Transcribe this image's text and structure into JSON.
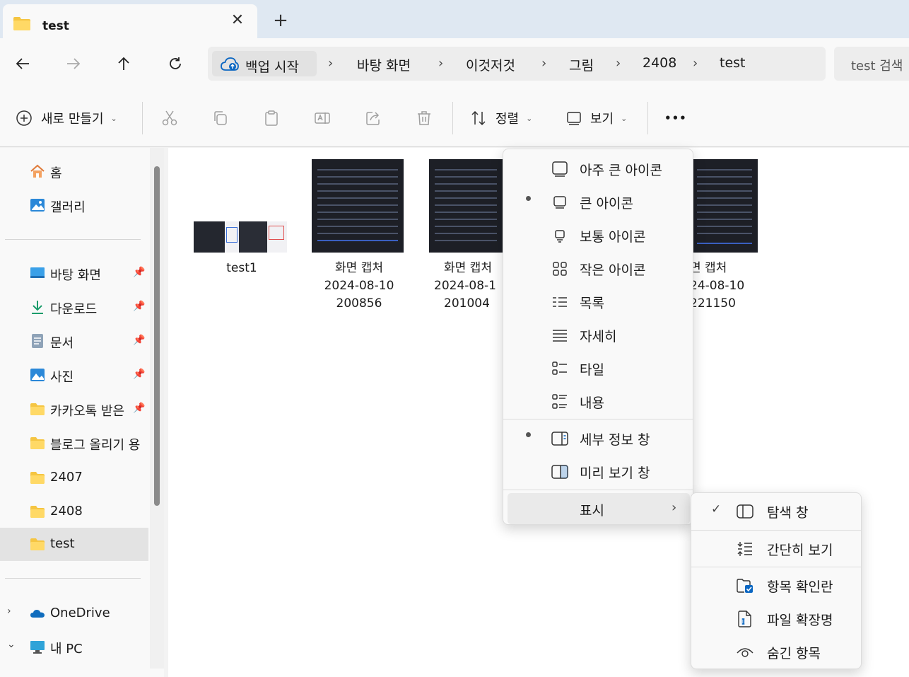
{
  "tab": {
    "title": "test",
    "close": "✕",
    "new": "+"
  },
  "address": {
    "backup": "백업 시작",
    "crumbs": [
      "바탕 화면",
      "이것저것",
      "그림",
      "2408",
      "test"
    ],
    "separator": "›"
  },
  "search": {
    "placeholder": "test 검색"
  },
  "toolbar": {
    "new_label": "새로 만들기",
    "sort_label": "정렬",
    "view_label": "보기",
    "more_label": "•••",
    "chevron": "⌄"
  },
  "sidebar": {
    "pin": "📌",
    "items": [
      {
        "label": "홈"
      },
      {
        "label": "갤러리"
      },
      {
        "label": "바탕 화면"
      },
      {
        "label": "다운로드"
      },
      {
        "label": "문서"
      },
      {
        "label": "사진"
      },
      {
        "label": "카카오톡 받은"
      },
      {
        "label": "블로그 올리기 용"
      },
      {
        "label": "2407"
      },
      {
        "label": "2408"
      },
      {
        "label": "test"
      },
      {
        "label": "OneDrive"
      },
      {
        "label": "내 PC"
      }
    ],
    "chev_right": "›",
    "chev_down": "⌄"
  },
  "files": [
    {
      "name": "test1"
    },
    {
      "name": "화면 캡처",
      "date": "2024-08-10",
      "time": "200856"
    },
    {
      "name": "화면 캡처",
      "date": "2024-08-1",
      "time": "201004"
    },
    {
      "name": "면 캡처",
      "date": "24-08-10",
      "time": "221150"
    }
  ],
  "view_menu": {
    "items": [
      {
        "label": "아주 큰 아이콘"
      },
      {
        "label": "큰 아이콘"
      },
      {
        "label": "보통 아이콘"
      },
      {
        "label": "작은 아이콘"
      },
      {
        "label": "목록"
      },
      {
        "label": "자세히"
      },
      {
        "label": "타일"
      },
      {
        "label": "내용"
      },
      {
        "label": "세부 정보 창"
      },
      {
        "label": "미리 보기 창"
      },
      {
        "label": "표시"
      }
    ],
    "arrow": "›"
  },
  "show_submenu": {
    "check": "✓",
    "items": [
      {
        "label": "탐색 창"
      },
      {
        "label": "간단히 보기"
      },
      {
        "label": "항목 확인란"
      },
      {
        "label": "파일 확장명"
      },
      {
        "label": "숨긴 항목"
      }
    ]
  },
  "colors": {
    "folder": "#f5c542",
    "accent": "#0a66c2",
    "highlight": "#e3e3e3"
  }
}
